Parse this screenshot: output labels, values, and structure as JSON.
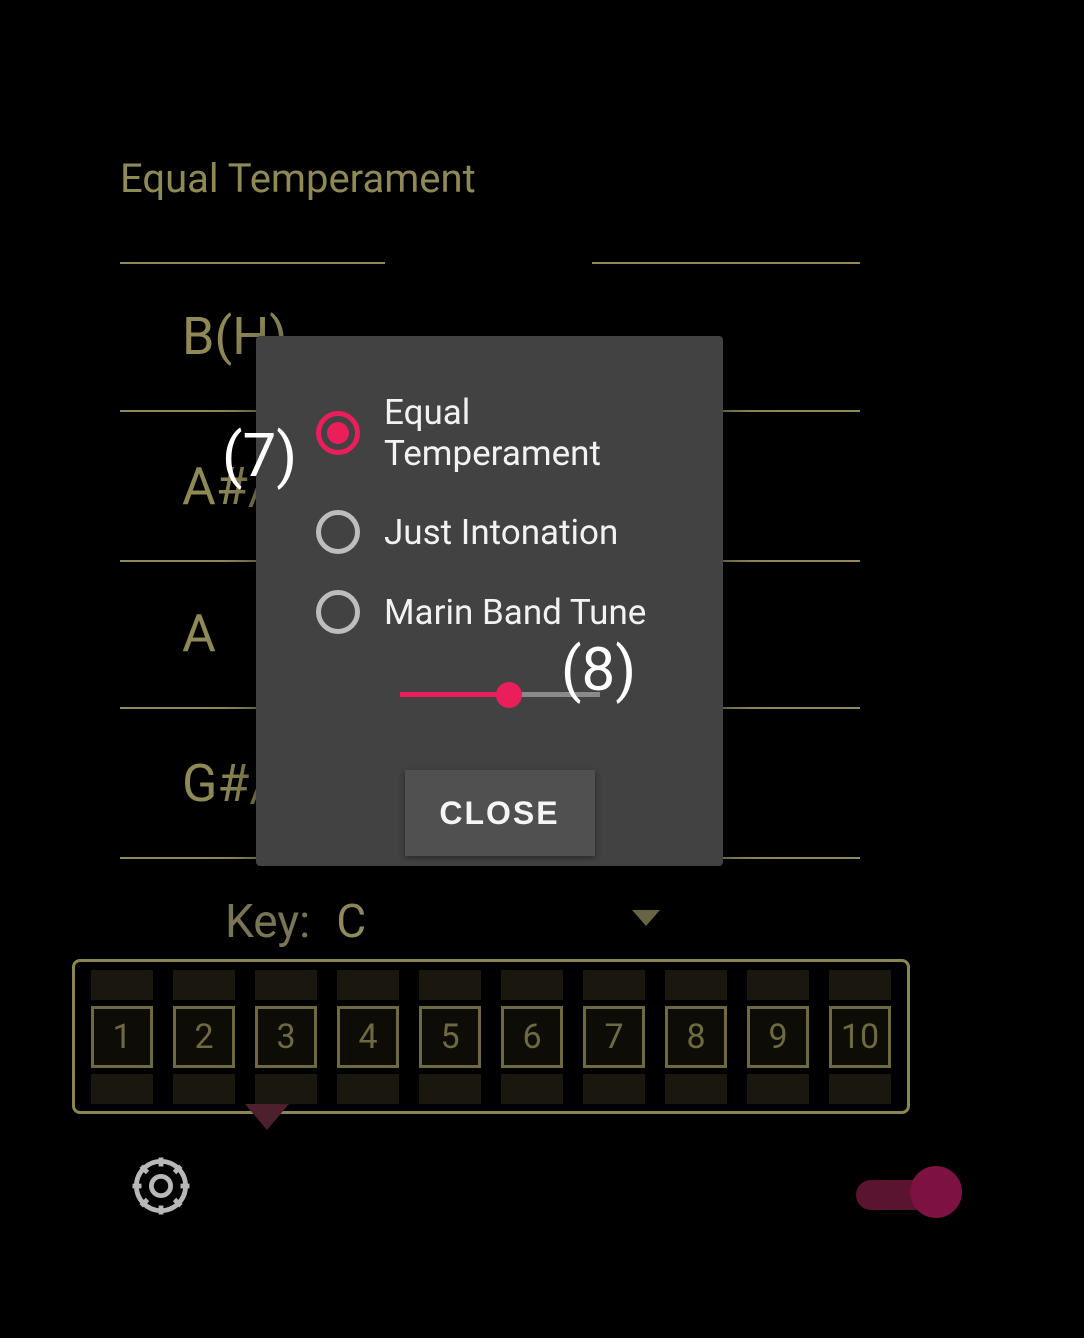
{
  "heading": "Equal Temperament",
  "notes": [
    "B(H)",
    "A#/",
    "A",
    "G#/"
  ],
  "key": {
    "label": "Key:",
    "value": "C"
  },
  "harmonica": {
    "holes": [
      "1",
      "2",
      "3",
      "4",
      "5",
      "6",
      "7",
      "8",
      "9",
      "10"
    ]
  },
  "dialog": {
    "options": [
      {
        "label": "Equal Temperament",
        "selected": true
      },
      {
        "label": "Just Intonation",
        "selected": false
      },
      {
        "label": "Marin Band Tune",
        "selected": false
      }
    ],
    "slider": {
      "value": 53
    },
    "close": "CLOSE"
  },
  "annotations": {
    "seven": "(7)",
    "eight": "(8)"
  }
}
